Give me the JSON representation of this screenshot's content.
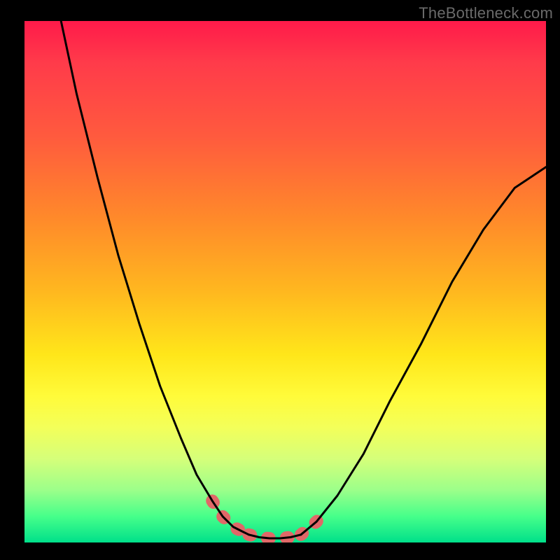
{
  "watermark": "TheBottleneck.com",
  "chart_data": {
    "type": "line",
    "title": "",
    "xlabel": "",
    "ylabel": "",
    "xlim": [
      0,
      100
    ],
    "ylim": [
      0,
      100
    ],
    "grid": false,
    "legend": false,
    "series": [
      {
        "name": "left-curve",
        "x": [
          7,
          10,
          14,
          18,
          22,
          26,
          30,
          33,
          36,
          38,
          40,
          42,
          43
        ],
        "y": [
          100,
          86,
          70,
          55,
          42,
          30,
          20,
          13,
          8,
          5,
          3,
          2,
          1.5
        ]
      },
      {
        "name": "valley-floor",
        "x": [
          43,
          45,
          47,
          49,
          51,
          53
        ],
        "y": [
          1.5,
          1,
          0.8,
          0.8,
          1,
          1.5
        ]
      },
      {
        "name": "right-curve",
        "x": [
          53,
          56,
          60,
          65,
          70,
          76,
          82,
          88,
          94,
          100
        ],
        "y": [
          1.5,
          4,
          9,
          17,
          27,
          38,
          50,
          60,
          68,
          72
        ]
      },
      {
        "name": "red-highlight-left",
        "x": [
          36,
          38,
          40,
          42,
          43
        ],
        "y": [
          8,
          5,
          3,
          2,
          1.5
        ]
      },
      {
        "name": "red-highlight-floor",
        "x": [
          43,
          45,
          47,
          49,
          51,
          53
        ],
        "y": [
          1.5,
          1,
          0.8,
          0.8,
          1,
          1.5
        ]
      },
      {
        "name": "red-highlight-right",
        "x": [
          53,
          56,
          58
        ],
        "y": [
          1.5,
          4,
          6.5
        ]
      }
    ],
    "colors": {
      "background_gradient": [
        "#ff1a4a",
        "#ff8a2a",
        "#ffe61a",
        "#00e08a"
      ],
      "main_curve": "#000000",
      "highlight_curve": "#e06868"
    }
  }
}
